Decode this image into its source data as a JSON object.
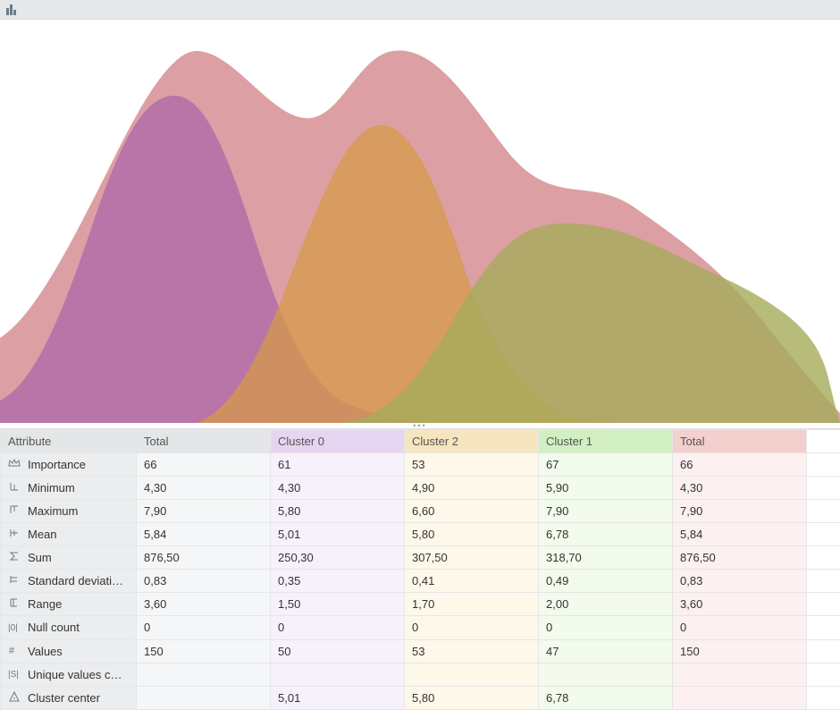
{
  "toolbar": {
    "chart_button_title": "Chart"
  },
  "table": {
    "columns": [
      {
        "key": "attr",
        "label": "Attribute",
        "cls": "col-attr"
      },
      {
        "key": "total",
        "label": "Total",
        "cls": "col-total"
      },
      {
        "key": "c0",
        "label": "Cluster 0",
        "cls": "col-c0"
      },
      {
        "key": "c2",
        "label": "Cluster 2",
        "cls": "col-c2"
      },
      {
        "key": "c1",
        "label": "Cluster 1",
        "cls": "col-c1"
      },
      {
        "key": "tot2",
        "label": "Total",
        "cls": "col-tot2"
      }
    ],
    "rows": [
      {
        "icon": "crown",
        "label": "Importance",
        "total": "66",
        "c0": "61",
        "c2": "53",
        "c1": "67",
        "tot2": "66"
      },
      {
        "icon": "min",
        "label": "Minimum",
        "total": "4,30",
        "c0": "4,30",
        "c2": "4,90",
        "c1": "5,90",
        "tot2": "4,30"
      },
      {
        "icon": "max",
        "label": "Maximum",
        "total": "7,90",
        "c0": "5,80",
        "c2": "6,60",
        "c1": "7,90",
        "tot2": "7,90"
      },
      {
        "icon": "mean",
        "label": "Mean",
        "total": "5,84",
        "c0": "5,01",
        "c2": "5,80",
        "c1": "6,78",
        "tot2": "5,84"
      },
      {
        "icon": "sigma",
        "label": "Sum",
        "total": "876,50",
        "c0": "250,30",
        "c2": "307,50",
        "c1": "318,70",
        "tot2": "876,50"
      },
      {
        "icon": "stdev",
        "label": "Standard deviati…",
        "total": "0,83",
        "c0": "0,35",
        "c2": "0,41",
        "c1": "0,49",
        "tot2": "0,83"
      },
      {
        "icon": "range",
        "label": "Range",
        "total": "3,60",
        "c0": "1,50",
        "c2": "1,70",
        "c1": "2,00",
        "tot2": "3,60"
      },
      {
        "icon": "null",
        "label": "Null count",
        "total": "0",
        "c0": "0",
        "c2": "0",
        "c1": "0",
        "tot2": "0"
      },
      {
        "icon": "hash",
        "label": "Values",
        "total": "150",
        "c0": "50",
        "c2": "53",
        "c1": "47",
        "tot2": "150"
      },
      {
        "icon": "unique",
        "label": "Unique values c…",
        "total": "",
        "c0": "",
        "c2": "",
        "c1": "",
        "tot2": ""
      },
      {
        "icon": "center",
        "label": "Cluster center",
        "total": "",
        "c0": "5,01",
        "c2": "5,80",
        "c1": "6,78",
        "tot2": ""
      }
    ]
  },
  "chart_data": {
    "type": "area",
    "description": "Overlapping density distributions for clusters",
    "series": [
      {
        "name": "Total",
        "color": "#d68e93",
        "opacity": 0.85
      },
      {
        "name": "Cluster 0",
        "color": "#b06aa8",
        "opacity": 0.8
      },
      {
        "name": "Cluster 2",
        "color": "#d79a4a",
        "opacity": 0.75
      },
      {
        "name": "Cluster 1",
        "color": "#a6ab5a",
        "opacity": 0.8
      }
    ],
    "x_range_estimate": [
      4.0,
      8.0
    ]
  }
}
